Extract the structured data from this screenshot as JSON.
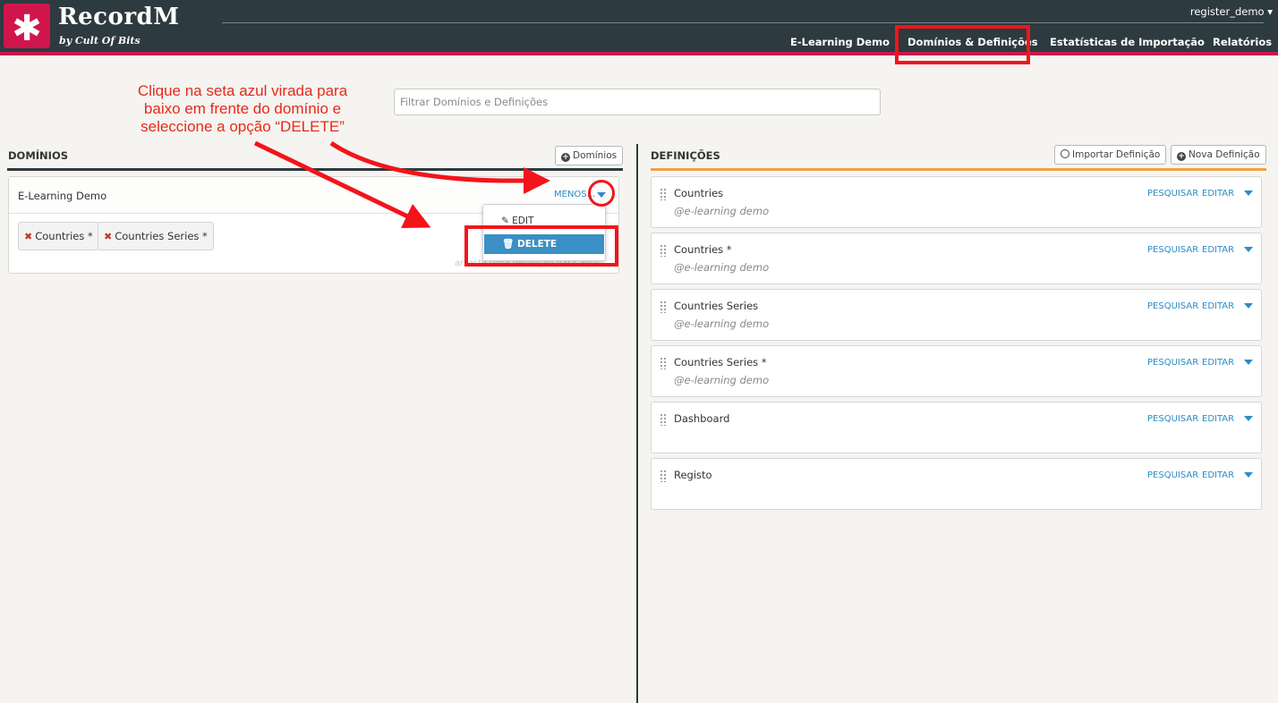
{
  "header": {
    "logo_glyph": "✱",
    "app_title": "RecordM",
    "app_subtitle": "by Cult Of Bits",
    "user": "register_demo ▾",
    "nav": [
      "E-Learning Demo",
      "Domínios & Definições",
      "Estatísticas de Importação",
      "Relatórios"
    ],
    "active_nav": "Domínios & Definições"
  },
  "annotation": "Clique na seta azul virada para baixo em frente do domínio e seleccione a opção “DELETE”",
  "filter": {
    "placeholder": "Filtrar Domínios e Definições"
  },
  "domains": {
    "title": "DOMÍNIOS",
    "add_button": "Domínios",
    "card": {
      "name": "E-Learning Demo",
      "toggle": "MENOS...",
      "tags": [
        "Countries *",
        "Countries Series *"
      ],
      "footer": "arraste uma definição para aqui"
    },
    "menu": {
      "edit": "EDIT",
      "delete": "DELETE"
    }
  },
  "definitions": {
    "title": "DEFINIÇÕES",
    "import_button": "Importar Definição",
    "new_button": "Nova Definição",
    "actions": {
      "search": "PESQUISAR",
      "edit": "EDITAR"
    },
    "items": [
      {
        "name": "Countries",
        "domain": "@e-learning demo"
      },
      {
        "name": "Countries *",
        "domain": "@e-learning demo"
      },
      {
        "name": "Countries Series",
        "domain": "@e-learning demo"
      },
      {
        "name": "Countries Series *",
        "domain": "@e-learning demo"
      },
      {
        "name": "Dashboard",
        "domain": ""
      },
      {
        "name": "Registo",
        "domain": ""
      }
    ]
  },
  "colors": {
    "header_bg": "#2d3a3f",
    "brand": "#d0154d",
    "link_blue": "#2b8dc6",
    "annotation_red": "#f3141b",
    "definitions_accent": "#f0a045"
  }
}
